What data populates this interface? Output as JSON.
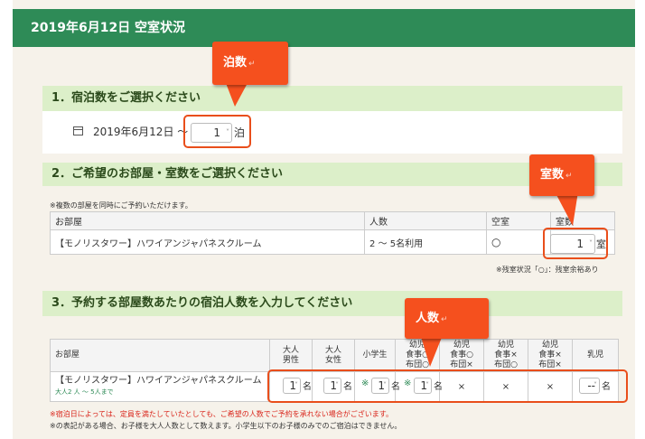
{
  "header": {
    "title": "2019年6月12日 空室状況"
  },
  "section1": {
    "title": "1．宿泊数をご選択ください",
    "date_text": "2019年6月12日 ～",
    "nights_value": "1",
    "nights_unit": "泊"
  },
  "section2": {
    "title": "2．ご希望のお部屋・室数をご選択ください",
    "note": "※複数の部屋を同時にご予約いただけます。",
    "headers": [
      "お部屋",
      "人数",
      "空室",
      "室数"
    ],
    "row": {
      "room": "【モノリスタワー】ハワイアンジャパネスクルーム",
      "capacity": "2 ～ 5名利用",
      "availability": "○",
      "rooms_value": "1",
      "rooms_unit": "室"
    },
    "legend": "※残室状況「○」：残室余裕あり"
  },
  "section3": {
    "title": "3．予約する部屋数あたりの宿泊人数を入力してください",
    "headers": [
      "お部屋",
      "大人\n男性",
      "大人\n女性",
      "小学生",
      "幼児\n食事○\n布団○",
      "幼児\n食事○\n布団×",
      "幼児\n食事×\n布団○",
      "幼児\n食事×\n布団×",
      "乳児"
    ],
    "row": {
      "room": "【モノリスタワー】ハワイアンジャパネスクルーム",
      "sub": "大人2 人 ～ 5人まで",
      "adult_male": "1",
      "adult_female": "1",
      "elementary": "1",
      "infant_meal_futon": "1",
      "infant_meal_nofuton": "×",
      "infant_nomeal_futon": "×",
      "infant_nomeal_nofuton": "×",
      "baby": "--",
      "unit": "名",
      "asterisk": "※"
    },
    "note1": "※宿泊日によっては、定員を満たしていたとしても、ご希望の人数でご予約を承れない場合がございます。",
    "note2": "※の表記がある場合、お子様を大人人数として数えます。小学生以下のお子様のみでのご宿泊はできません。"
  },
  "callouts": {
    "nights": "泊数",
    "rooms": "室数",
    "people": "人数"
  },
  "colors": {
    "header_bg": "#2e8b57",
    "section_bg": "#dcefc9",
    "callout": "#f5501e",
    "highlight_border": "#e94e1b"
  }
}
